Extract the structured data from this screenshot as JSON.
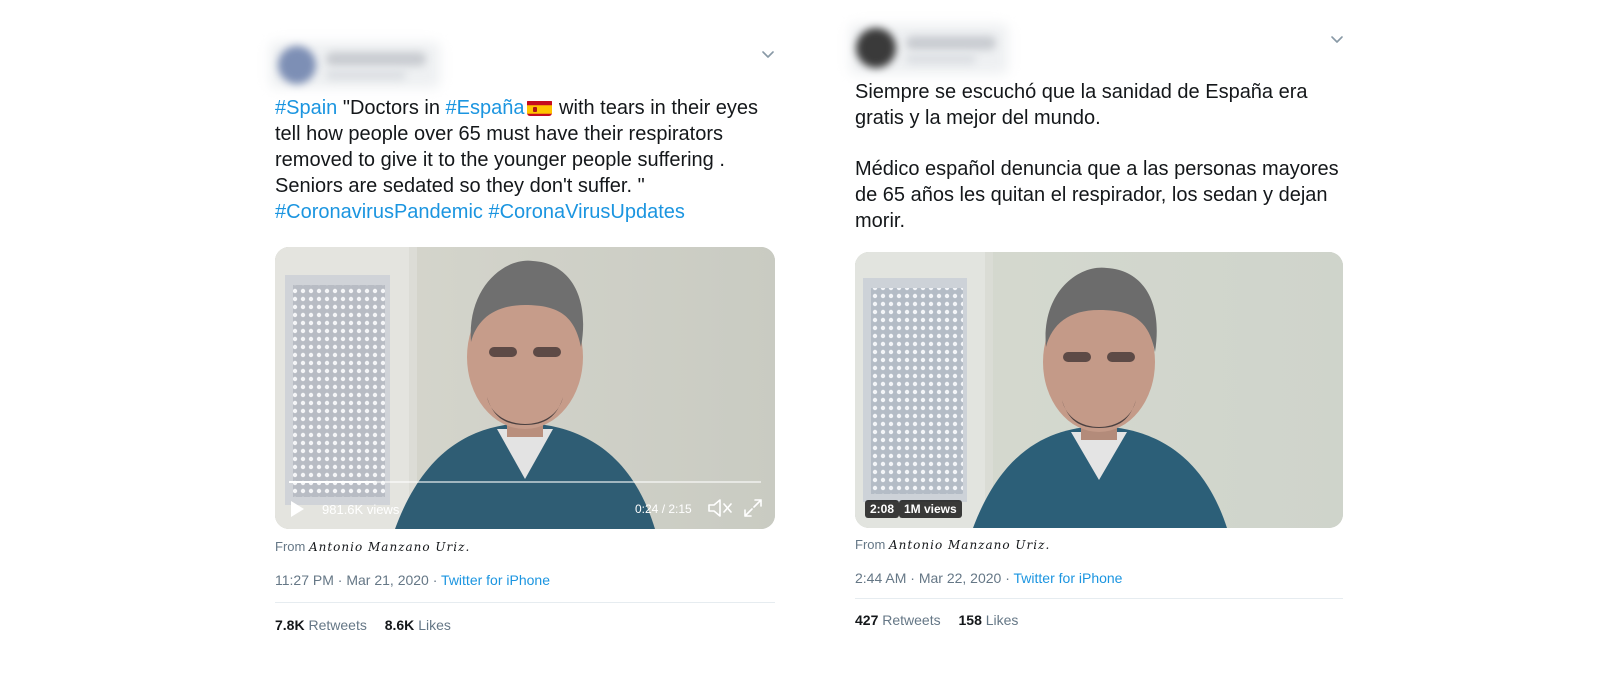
{
  "tweets": [
    {
      "text_parts": {
        "hashtag_spain": "#Spain",
        "text_a": " \"Doctors in ",
        "hashtag_espana": "#España",
        "text_b": " with tears in their eyes",
        "line2": "tell how people over 65 must have their respirators",
        "line3": "removed to give it to the younger people suffering .",
        "line4": "Seniors are sedated so they don't suffer. \"",
        "hashtag_pandemic": "#CoronavirusPandemic",
        "hashtag_updates": "#CoronaVirusUpdates"
      },
      "flag_icon": "spain-flag-emoji",
      "video": {
        "views": "981.6K views",
        "time": "0:24 / 2:15",
        "progress": 0.18,
        "play_icon": "play-icon",
        "mute_icon": "mute-icon",
        "fullscreen_icon": "fullscreen-icon"
      },
      "from_label": "From",
      "from_name": "Antonio Manzano Uriz.",
      "time": "11:27 PM",
      "date": "Mar 21, 2020",
      "source": "Twitter for iPhone",
      "retweets_count": "7.8K",
      "retweets_label": "Retweets",
      "likes_count": "8.6K",
      "likes_label": "Likes"
    },
    {
      "lines": [
        "Siempre se escuchó que la sanidad de España era",
        "gratis y la mejor del mundo.",
        "Médico español denuncia que a las personas mayores",
        "de 65 años les quitan el respirador, los sedan y dejan",
        "morir."
      ],
      "video": {
        "duration": "2:08",
        "views": "1M views"
      },
      "from_label": "From",
      "from_name": "Antonio Manzano Uriz.",
      "time": "2:44 AM",
      "date": "Mar 22, 2020",
      "source": "Twitter for iPhone",
      "retweets_count": "427",
      "retweets_label": "Retweets",
      "likes_count": "158",
      "likes_label": "Likes"
    }
  ],
  "separator": " · ",
  "colors": {
    "link": "#1b95e0",
    "text": "#14171a",
    "muted": "#657786",
    "divider": "#e6ecf0"
  }
}
